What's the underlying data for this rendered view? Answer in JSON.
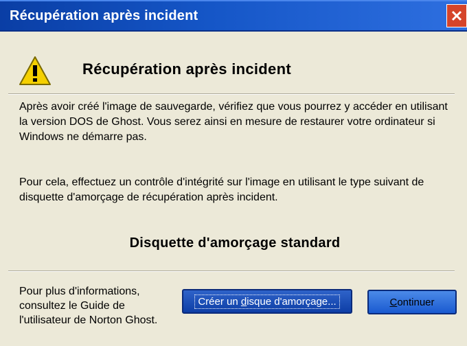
{
  "window": {
    "title": "Récupération après incident",
    "close_symbol": "✕"
  },
  "dialog": {
    "heading": "Récupération après incident",
    "warning_icon": "warning-icon",
    "paragraph1": "Après avoir créé l'image de sauvegarde, vérifiez que vous pourrez y accéder en utilisant la version DOS de Ghost. Vous serez ainsi en mesure de restaurer votre ordinateur si Windows ne démarre pas.",
    "paragraph2": "Pour cela, effectuez un contrôle d'intégrité sur l'image en utilisant le type suivant de disquette d'amorçage de récupération après incident.",
    "boot_disk_type": "Disquette d'amorçage standard",
    "info_line1": "Pour plus d'informations,",
    "info_line2": "consultez le Guide de",
    "info_line3": "l'utilisateur de Norton Ghost."
  },
  "buttons": {
    "create_boot_disk": {
      "before": "Créer un ",
      "underlined": "d",
      "after": "isque d'amorçage..."
    },
    "continue": {
      "underlined": "C",
      "after": "ontinuer"
    }
  },
  "colors": {
    "titlebar": "#0a3ea5",
    "dialog_bg": "#ece9d8",
    "close_button": "#d5442a",
    "warning_yellow": "#f5d000"
  }
}
